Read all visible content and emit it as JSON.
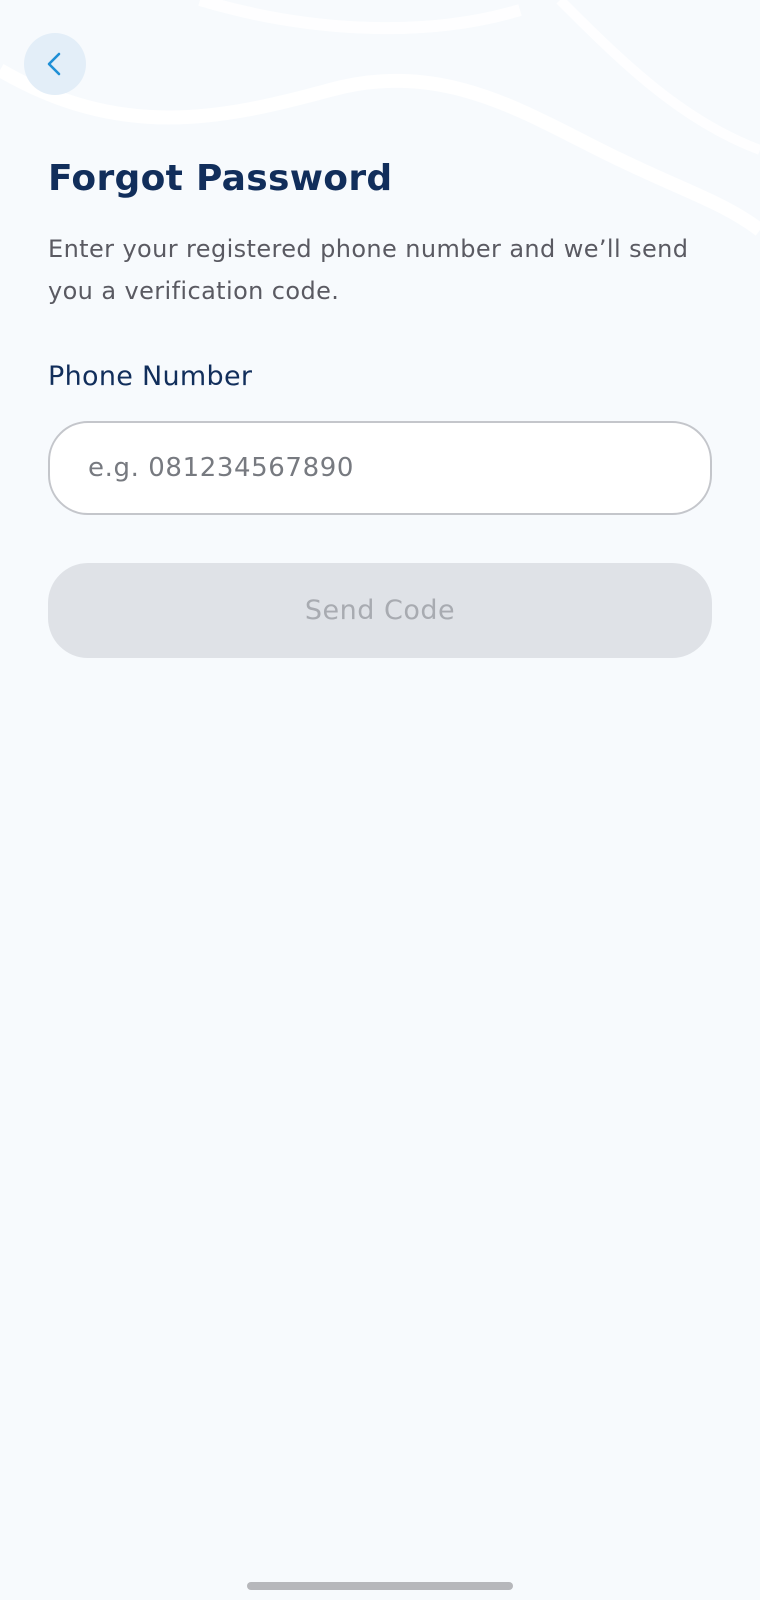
{
  "header": {
    "back_icon": "chevron-left-icon"
  },
  "main": {
    "title": "Forgot Password",
    "subtitle": "Enter your registered phone number and we’ll send you a verification code.",
    "phone_field": {
      "label": "Phone Number",
      "value": "",
      "placeholder": "e.g. 081234567890"
    },
    "send_button": {
      "label": "Send Code",
      "state": "disabled"
    }
  },
  "colors": {
    "background": "#f7fafd",
    "title": "#112e5b",
    "accent": "#1e8fd6",
    "disabled_button": "#dfe2e7",
    "disabled_text": "#a8abb1"
  }
}
